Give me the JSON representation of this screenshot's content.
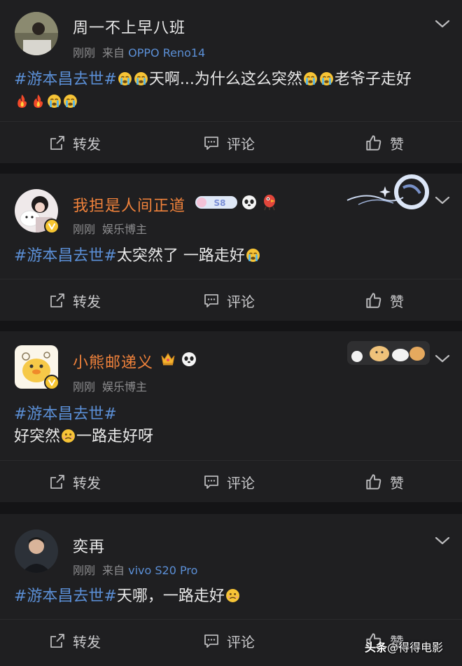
{
  "posts": [
    {
      "username": "周一不上早八班",
      "time": "刚刚",
      "source_prefix": "来自",
      "device": "OPPO Reno14",
      "hashtag": "#游本昌去世#",
      "text_a": "天啊...为什么这么突然",
      "text_b": "老爷子走好"
    },
    {
      "username": "我担是人间正道",
      "time": "刚刚",
      "role": "娱乐博主",
      "hashtag": "#游本昌去世#",
      "text_a": "太突然了 一路走好",
      "level_badge": "S8"
    },
    {
      "username": "小熊邮递义",
      "time": "刚刚",
      "role": "娱乐博主",
      "hashtag": "#游本昌去世#",
      "text_a": "好突然",
      "text_b": "一路走好呀"
    },
    {
      "username": "奕再",
      "time": "刚刚",
      "source_prefix": "来自",
      "device": "vivo S20 Pro",
      "hashtag": "#游本昌去世#",
      "text_a": "天哪，一路走好"
    }
  ],
  "actions": {
    "repost": "转发",
    "comment": "评论",
    "like": "赞"
  },
  "watermark": {
    "brand": "头条",
    "sep": "@",
    "account": "得得电影"
  },
  "colors": {
    "background": "#1f1f21",
    "hashtag": "#5b8fd6",
    "orange_name": "#f0823b",
    "meta": "#8d8d8f"
  },
  "icons": [
    "chevron-down-icon",
    "share-icon",
    "comment-icon",
    "thumbs-up-icon",
    "crying-emoji",
    "fire-emoji",
    "panda-emoji",
    "crown-emoji",
    "verified-badge"
  ]
}
